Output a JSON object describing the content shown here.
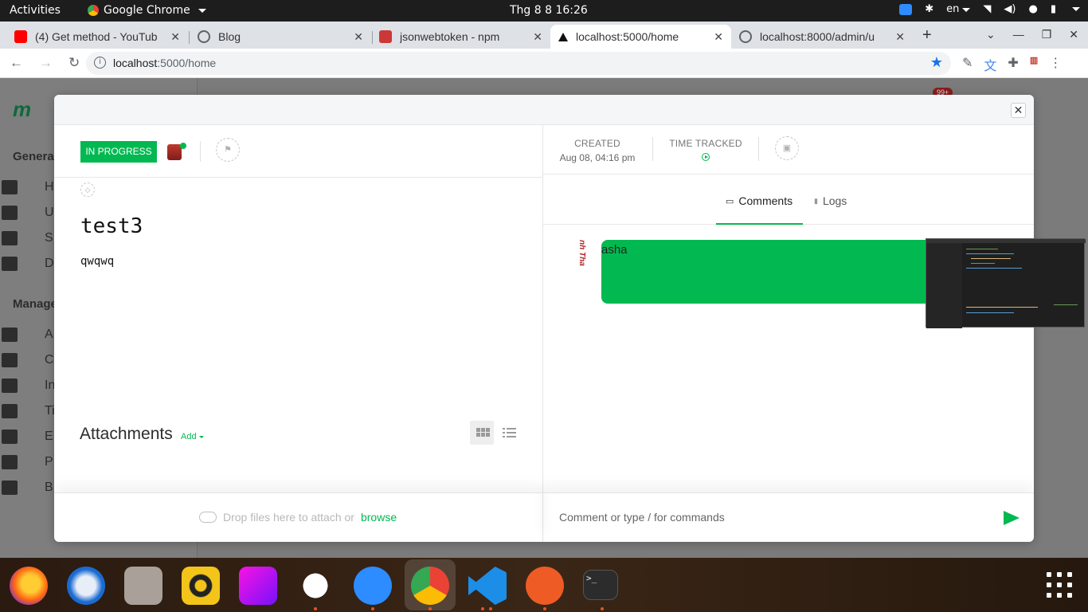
{
  "os": {
    "activities": "Activities",
    "app_name": "Google Chrome",
    "clock": "Thg 8 8  16:26",
    "lang": "en"
  },
  "browser": {
    "tabs": [
      {
        "title": "(4) Get method - YouTub",
        "favicon": "youtube-icon",
        "color": "#ff0000"
      },
      {
        "title": "Blog",
        "favicon": "globe-icon",
        "color": "#5f6368"
      },
      {
        "title": "jsonwebtoken - npm",
        "favicon": "npm-icon",
        "color": "#cb3837"
      },
      {
        "title": "localhost:5000/home",
        "favicon": "triangle-icon",
        "color": "#111111",
        "active": true
      },
      {
        "title": "localhost:8000/admin/u",
        "favicon": "globe-icon",
        "color": "#5f6368"
      }
    ],
    "url_host": "localhost",
    "url_path": ":5000/home"
  },
  "bg_app": {
    "badge": "99+",
    "section_general": "Genera",
    "section_manage": "Manage",
    "nav_letters": [
      "H",
      "U",
      "S",
      "D",
      "A",
      "C",
      "In",
      "Ti",
      "E",
      "P",
      "B"
    ]
  },
  "task": {
    "status": "IN PROGRESS",
    "status_color": "#02b951",
    "title": "test3",
    "description": "qwqwq",
    "created_label": "CREATED",
    "created_value": "Aug 08, 04:16 pm",
    "time_tracked_label": "TIME TRACKED",
    "attachments_title": "Attachments",
    "attachments_add": "Add",
    "drop_text": "Drop files here to attach or",
    "browse_link": "browse"
  },
  "activity": {
    "tabs": [
      {
        "label": "Comments",
        "icon": "comment-icon",
        "active": true
      },
      {
        "label": "Logs",
        "icon": "log-icon",
        "active": false
      }
    ],
    "comments": [
      {
        "author_avatar": "avatar",
        "text": "asha"
      }
    ],
    "input_placeholder": "Comment or type / for commands"
  },
  "dock": {
    "apps": [
      "firefox-icon",
      "thunderbird-icon",
      "files-icon",
      "rhythmbox-icon",
      "clickup-icon",
      "slack-icon",
      "zoom-icon",
      "chrome-icon",
      "vscode-icon",
      "postman-icon",
      "terminal-icon"
    ]
  }
}
